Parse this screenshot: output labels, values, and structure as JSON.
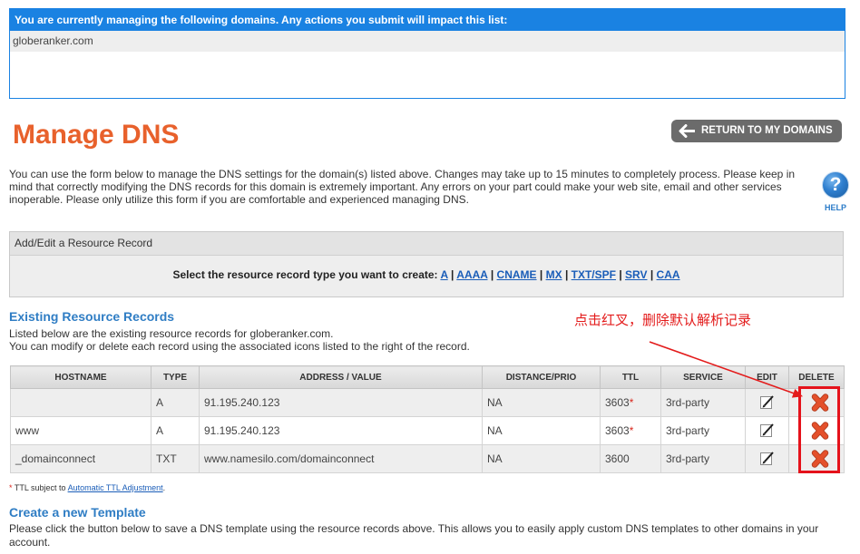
{
  "managed_domains": {
    "header": "You are currently managing the following domains. Any actions you submit will impact this list:",
    "domains": [
      "globeranker.com"
    ]
  },
  "page_title": "Manage DNS",
  "return_button": {
    "label": "RETURN TO MY DOMAINS",
    "icon": "arrow-left-icon"
  },
  "intro": "You can use the form below to manage the DNS settings for the domain(s) listed above. Changes may take up to 15 minutes to completely process. Please keep in mind that correctly modifying the DNS records for this domain is extremely important. Any errors on your part could make your web site, email and other services inoperable. Please only utilize this form if you are comfortable and experienced managing DNS.",
  "help": {
    "glyph": "?",
    "label": "HELP",
    "icon": "question-mark-icon"
  },
  "add_edit_panel": {
    "title": "Add/Edit a Resource Record",
    "prompt": "Select the resource record type you want to create:",
    "record_types": [
      "A",
      "AAAA",
      "CNAME",
      "MX",
      "TXT/SPF",
      "SRV",
      "CAA"
    ],
    "separator": "|"
  },
  "existing_records": {
    "title": "Existing Resource Records",
    "description": [
      "Listed below are the existing resource records for globeranker.com.",
      "You can modify or delete each record using the associated icons listed to the right of the record."
    ],
    "columns": [
      "HOSTNAME",
      "TYPE",
      "ADDRESS / VALUE",
      "DISTANCE/PRIO",
      "TTL",
      "SERVICE",
      "EDIT",
      "DELETE"
    ],
    "rows": [
      {
        "hostname": "",
        "type": "A",
        "address": "91.195.240.123",
        "distance": "NA",
        "ttl": "3603",
        "ttl_mark": "*",
        "service": "3rd-party",
        "edit_icon": "edit-icon",
        "delete_icon": "delete-icon"
      },
      {
        "hostname": "www",
        "type": "A",
        "address": "91.195.240.123",
        "distance": "NA",
        "ttl": "3603",
        "ttl_mark": "*",
        "service": "3rd-party",
        "edit_icon": "edit-icon",
        "delete_icon": "delete-icon"
      },
      {
        "hostname": "_domainconnect",
        "type": "TXT",
        "address": "www.namesilo.com/domainconnect",
        "distance": "NA",
        "ttl": "3600",
        "service": "3rd-party",
        "edit_icon": "edit-icon",
        "delete_icon": "delete-icon"
      }
    ]
  },
  "annotation": {
    "text": "点击红叉，删除默认解析记录"
  },
  "ttl_note": {
    "mark": "*",
    "text": "TTL subject to",
    "link": "Automatic TTL Adjustment",
    "suffix": "."
  },
  "template_section": {
    "title": "Create a new Template",
    "description": "Please click the button below to save a DNS template using the resource records above. This allows you to easily apply custom DNS templates to other domains in your account."
  },
  "colors": {
    "header_blue": "#1a82e2",
    "title_orange": "#e8612c",
    "section_blue": "#2f7dc4",
    "link_blue": "#1a5db8",
    "button_gray": "#6b6b6b",
    "annotation_red": "#e31b1b",
    "delete_red": "#e4502b",
    "asterisk_red": "#d9261c",
    "highlight_red": "#e5121b"
  }
}
